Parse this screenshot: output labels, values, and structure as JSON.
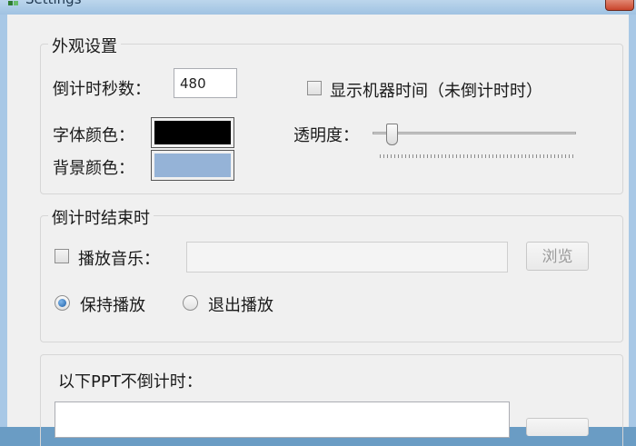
{
  "window": {
    "title": "Settings"
  },
  "appearance": {
    "legend": "外观设置",
    "countdown_label": "倒计时秒数：",
    "countdown_value": "480",
    "show_clock_label": "显示机器时间（未倒计时时）",
    "show_clock_checked": false,
    "font_color_label": "字体颜色：",
    "font_color": "#000000",
    "bg_color_label": "背景颜色：",
    "bg_color": "#95b3d7",
    "opacity_label": "透明度：",
    "opacity_fraction": 0.07
  },
  "on_end": {
    "legend": "倒计时结束时",
    "play_music_label": "播放音乐：",
    "play_music_checked": false,
    "music_path": "",
    "browse_label": "浏览",
    "keep_playing_label": "保持播放",
    "exit_playing_label": "退出播放",
    "selected": "keep_playing"
  },
  "exclude": {
    "label": "以下PPT不倒计时：",
    "list_value": ""
  }
}
